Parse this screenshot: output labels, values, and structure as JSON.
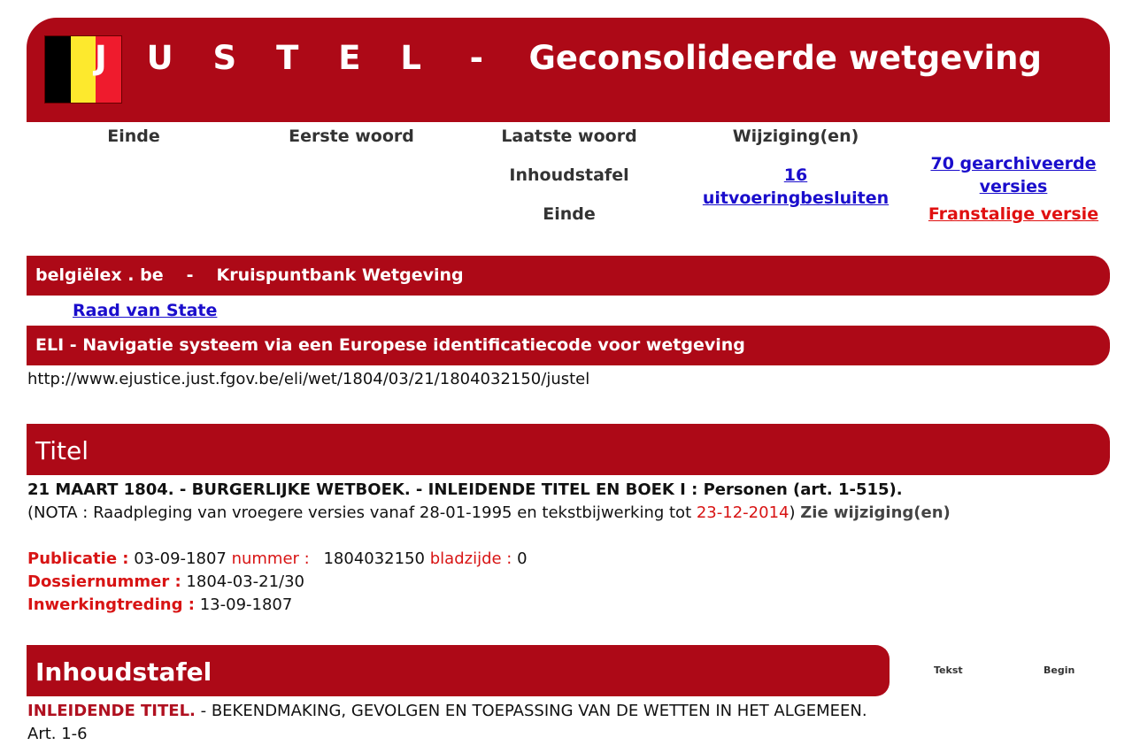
{
  "banner": {
    "brand": "J U S T E L",
    "separator": "-",
    "subtitle": "Geconsolideerde wetgeving",
    "flag_colors": [
      "#000000",
      "#fde92d",
      "#ef1b2d"
    ]
  },
  "nav": {
    "einde_top": "Einde",
    "eerste_woord": "Eerste woord",
    "laatste_woord": "Laatste woord",
    "wijzigingen": "Wijziging(en)",
    "inhoudstafel": "Inhoudstafel",
    "uitvoeringsbesluiten": "16 uitvoeringbesluiten",
    "gearchiveerde_versies": "70 gearchiveerde versies",
    "einde_bottom": "Einde",
    "franstalige_versie": "Franstalige versie"
  },
  "belgielex_bar": {
    "site": "belgiëlex . be",
    "separator": "-",
    "label": "Kruispuntbank Wetgeving"
  },
  "raad_van_state": "Raad van State",
  "eli_bar": "ELI - Navigatie systeem via een Europese identificatiecode voor wetgeving",
  "eli_url": "http://www.ejustice.just.fgov.be/eli/wet/1804/03/21/1804032150/justel",
  "titel_bar": "Titel",
  "document": {
    "heading": "21 MAART 1804. - BURGERLIJKE WETBOEK. - INLEIDENDE TITEL EN BOEK I : Personen (art. 1-515).",
    "nota_prefix": "(NOTA : Raadpleging van vroegere versies vanaf 28-01-1995 en tekstbijwerking tot ",
    "nota_date": "23-12-2014",
    "nota_suffix": ")",
    "zie_wijzigingen": "Zie wijziging(en)",
    "publicatie_label": "Publicatie :",
    "publicatie_value": "03-09-1807",
    "nummer_label": "nummer :",
    "nummer_value": "1804032150",
    "bladzijde_label": "bladzijde :",
    "bladzijde_value": "0",
    "dossier_label": "Dossiernummer :",
    "dossier_value": "1804-03-21/30",
    "inwerking_label": "Inwerkingtreding :",
    "inwerking_value": "13-09-1807"
  },
  "toc": {
    "title": "Inhoudstafel",
    "tekst": "Tekst",
    "begin": "Begin",
    "entry_label": "INLEIDENDE TITEL.",
    "entry_text": " - BEKENDMAKING, GEVOLGEN EN TOEPASSING VAN DE WETTEN IN HET ALGEMEEN.",
    "entry_articles": "Art. 1-6"
  },
  "colors": {
    "brand_red": "#ad0917",
    "label_red": "#d81414",
    "link_blue": "#1a0dcc"
  }
}
